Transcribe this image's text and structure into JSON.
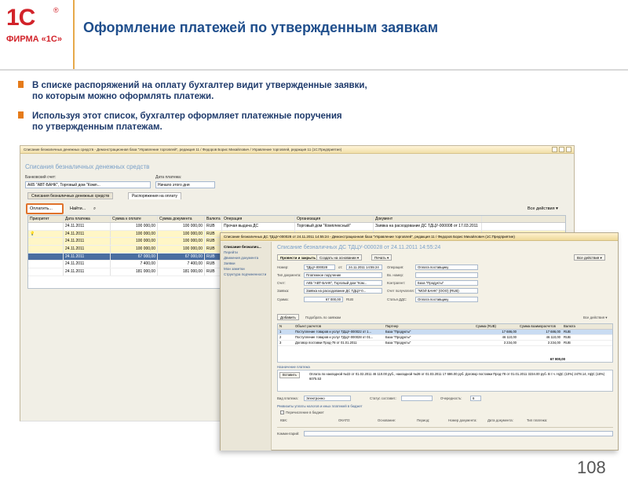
{
  "logo": {
    "big": "1С",
    "reg": "®",
    "firm": "ФИРМА «1С»"
  },
  "slide": {
    "title": "Оформление платежей по утвержденным заявкам",
    "bullets": [
      "В списке распоряжений на оплату бухгалтер видит утвержденные заявки,\nпо которым можно оформлять платежи.",
      "Используя этот список, бухгалтер оформляет платежные поручения\nпо утвержденным платежам."
    ],
    "page_number": "108"
  },
  "win1": {
    "title": "Списание безналичных денежных средств - Демонстрационная база \"Управление торговлей\", редакция 11 / Федоров Борис Михайлович / Управление торговлей, редакция 11 (1С:Предприятие)",
    "header": "Списания безналичных денежных средств",
    "bank_label": "Банковский счет:",
    "bank_value": "АКБ \"АВТ-БАНК\", Торговый дом \"Комп...",
    "date_label": "Дата платежа:",
    "date_value": "Начало этого дня",
    "tabs": [
      "Списания безналичных денежных средств",
      "Распоряжения на оплату"
    ],
    "toolbar": {
      "pay": "Оплатить...",
      "find": "Найти...",
      "all_actions": "Все действия ▾"
    },
    "columns": [
      "Приоритет",
      "Дата платежа",
      "Сумма к оплате",
      "Сумма документа",
      "Валюта",
      "Операция",
      "Организация",
      "Документ"
    ],
    "rows": [
      [
        "",
        "24.11.2011",
        "100 000,00",
        "100 000,00",
        "RUB",
        "Прочая выдача ДС",
        "Торговый дом \"Комплексный\"",
        "Заявка на расходование ДС ТДЦУ-000008 от 17.03.2011"
      ],
      [
        "",
        "24.11.2011",
        "100 000,00",
        "100 000,00",
        "RUB",
        "",
        "",
        ""
      ],
      [
        "",
        "24.11.2011",
        "100 000,00",
        "100 000,00",
        "RUB",
        "",
        "",
        ""
      ],
      [
        "",
        "24.11.2011",
        "100 000,00",
        "100 000,00",
        "RUB",
        "",
        "",
        ""
      ],
      [
        "",
        "24.11.2011",
        "67 000,00",
        "67 000,00",
        "RUB",
        "",
        "",
        ""
      ],
      [
        "",
        "24.11.2011",
        "7 400,00",
        "7 400,00",
        "RUB",
        "",
        "",
        ""
      ],
      [
        "",
        "24.11.2011",
        "181 000,00",
        "181 000,00",
        "RUB",
        "",
        "",
        ""
      ]
    ]
  },
  "win2": {
    "title": "Списание безналичных ДС ТДЦУ-000028 от 24.11.2011 14:55:24 - Демонстрационная база \"Управление торговлей\", редакция 11 / Федоров Борис Михайлович (1С:Предприятие)",
    "side": {
      "header": "Списание безналич...",
      "links": [
        "Перейти",
        "Движения документа",
        "Заявки",
        "Мои заметки",
        "Структура подчиненности"
      ]
    },
    "header": "Списание безналичных ДС ТДЦУ-000028 от 24.11.2011 14:55:24",
    "buttons": {
      "post_close": "Провести и закрыть",
      "create_based": "Создать на основании ▾",
      "print": "Печать ▾",
      "all_actions": "Все действия ▾",
      "add": "Добавить",
      "select": "Подобрать по заявкам",
      "all_actions2": "Все действия ▾"
    },
    "fields": {
      "number_label": "Номер:",
      "number": "ТДЦУ-000028",
      "from_label": "от:",
      "date": "24.11.2011 14:55:24",
      "op_label": "Операция:",
      "op": "Оплата поставщику",
      "type_label": "Тип документа:",
      "type": "Платежное поручение",
      "in_number_label": "Вх. номер:",
      "bank_label": "Счет:",
      "bank": "АКБ \"АВТ-БАНК\", Торговый дом \"Ком...",
      "contractor_label": "Контрагент:",
      "contractor": "База \"Продукты\"",
      "request_label": "Заявка:",
      "request": "Заявка на расходование ДС ТДЦУ-0...",
      "acct_label": "Счет получателя:",
      "acct": "\"МОЙ БАНК\" (ООО) (RUB)",
      "sum_label": "Сумма:",
      "sum": "67 000,00",
      "currency": "RUB",
      "dds_label": "Статья ДДС:",
      "dds": "Оплата поставщику"
    },
    "grid_columns": [
      "N",
      "Объект расчетов",
      "Партнер",
      "Сумма (RUB)",
      "Сумма взаиморасчетов",
      "Валюта"
    ],
    "grid_rows": [
      [
        "1",
        "Поступление товаров и услуг ТДЦУ-000022 от 1...",
        "База \"Продукты\"",
        "17 686,00",
        "17 686,00",
        "RUB"
      ],
      [
        "2",
        "Поступление товаров и услуг ТДЦУ-000028 от 01...",
        "База \"Продукты\"",
        "46 110,00",
        "46 110,00",
        "RUB"
      ],
      [
        "3",
        "Договор поставки Прод-78 от 01.01.2011",
        "База \"Продукты\"",
        "3 234,00",
        "3 234,00",
        "RUB"
      ]
    ],
    "grid_total": "67 000,00",
    "purpose_label": "Назначение платежа",
    "purpose_btn": "Вставить",
    "purpose_text": "Оплата по накладной №22 от 01.02.2011 46 110.00 руб., накладной №28 от 01.03.2011 17 686.00 руб. Договор поставки Прод-78 от 01.01.2011 3234.00 руб. В т.ч. НДС (10%) 2478.14, НДС (18%) 6075.53",
    "payment_type_label": "Вид платежа:",
    "payment_type": "Электронно",
    "status_label": "Статус составит.:",
    "priority_label": "Очередность:",
    "priority": "6",
    "budget_label": "Реквизиты уплаты налогов и иных платежей в бюджет",
    "budget_check": "Перечисление в бюджет",
    "budget_cols": [
      "КБК:",
      "ОКАТО:",
      "Основание:",
      "Период:",
      "Номер документа:",
      "Дата документа:",
      "Тип платежа:"
    ],
    "comment_label": "Комментарий:"
  }
}
